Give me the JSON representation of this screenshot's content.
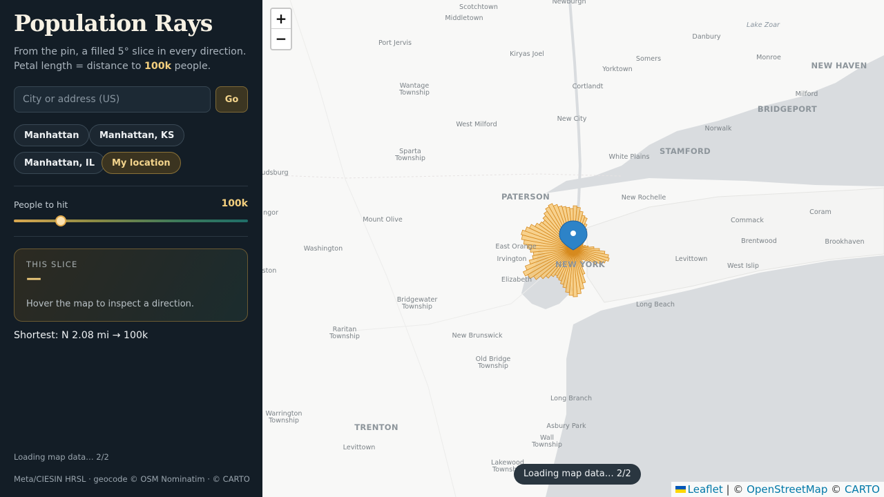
{
  "sidebar": {
    "title": "Population Rays",
    "subtitle_line1": "From the pin, a filled 5° slice in every direction.",
    "subtitle_line2_prefix": "Petal length = distance to",
    "subtitle_line2_highlight": "100k",
    "subtitle_line2_suffix": "people.",
    "search": {
      "placeholder": "City or address (US)",
      "value": "",
      "go_label": "Go"
    },
    "chips": [
      {
        "label": "Manhattan",
        "active": false
      },
      {
        "label": "Manhattan, KS",
        "active": false
      },
      {
        "label": "Manhattan, IL",
        "active": false
      },
      {
        "label": "My location",
        "active": true
      }
    ],
    "people": {
      "label": "People to hit",
      "value_label": "100k",
      "slider_fraction": 0.2
    },
    "slice": {
      "heading": "THIS SLICE",
      "value": "—",
      "hint": "Hover the map to inspect a direction."
    },
    "shortest": "Shortest: N 2.08 mi → 100k",
    "loading": "Loading map data… 2/2",
    "credits": "Meta/CIESIN HRSL · geocode © OSM Nominatim · © CARTO"
  },
  "map": {
    "zoom_in_label": "+",
    "zoom_out_label": "−",
    "loading_pill": "Loading map data… 2/2",
    "attribution": {
      "leaflet": "Leaflet",
      "sep1": " | © ",
      "osm": "OpenStreetMap",
      "sep2": " © ",
      "carto": "CARTO"
    },
    "colors": {
      "petal_fill": "#f7c46a",
      "petal_stroke": "#d68a1f",
      "pin": "#2d83c8",
      "water": "#d9dcdf",
      "land": "#f8f8f7"
    },
    "places": [
      {
        "name": "Scotchtown",
        "type": "town"
      },
      {
        "name": "Newburgh",
        "type": "town"
      },
      {
        "name": "Middletown",
        "type": "town"
      },
      {
        "name": "Port Jervis",
        "type": "town"
      },
      {
        "name": "Kiryas Joel",
        "type": "town"
      },
      {
        "name": "Lake Zoar",
        "type": "water"
      },
      {
        "name": "Danbury",
        "type": "town"
      },
      {
        "name": "Monroe",
        "type": "town"
      },
      {
        "name": "Somers",
        "type": "town"
      },
      {
        "name": "NEW HAVEN",
        "type": "city"
      },
      {
        "name": "Yorktown",
        "type": "town"
      },
      {
        "name": "Wantage Township",
        "type": "town"
      },
      {
        "name": "Cortlandt",
        "type": "town"
      },
      {
        "name": "Milford",
        "type": "town"
      },
      {
        "name": "BRIDGEPORT",
        "type": "city"
      },
      {
        "name": "West Milford",
        "type": "town"
      },
      {
        "name": "New City",
        "type": "town"
      },
      {
        "name": "Norwalk",
        "type": "town"
      },
      {
        "name": "Sparta Township",
        "type": "town"
      },
      {
        "name": "STAMFORD",
        "type": "city"
      },
      {
        "name": "White Plains",
        "type": "town"
      },
      {
        "name": "udsburg",
        "type": "town"
      },
      {
        "name": "PATERSON",
        "type": "city"
      },
      {
        "name": "New Rochelle",
        "type": "town"
      },
      {
        "name": "Coram",
        "type": "town"
      },
      {
        "name": "Commack",
        "type": "town"
      },
      {
        "name": "ngor",
        "type": "town"
      },
      {
        "name": "Mount Olive",
        "type": "town"
      },
      {
        "name": "Brentwood",
        "type": "town"
      },
      {
        "name": "Brookhaven",
        "type": "town"
      },
      {
        "name": "Washington",
        "type": "town"
      },
      {
        "name": "East Orange",
        "type": "town"
      },
      {
        "name": "Levittown",
        "type": "town"
      },
      {
        "name": "Irvington",
        "type": "town"
      },
      {
        "name": "NEW YORK",
        "type": "city"
      },
      {
        "name": "West Islip",
        "type": "town"
      },
      {
        "name": "ston",
        "type": "town"
      },
      {
        "name": "Elizabeth",
        "type": "town"
      },
      {
        "name": "Bridgewater Township",
        "type": "town"
      },
      {
        "name": "Long Beach",
        "type": "town"
      },
      {
        "name": "Raritan Township",
        "type": "town"
      },
      {
        "name": "New Brunswick",
        "type": "town"
      },
      {
        "name": "Old Bridge Township",
        "type": "town"
      },
      {
        "name": "Long Branch",
        "type": "town"
      },
      {
        "name": "Warrington Township",
        "type": "town"
      },
      {
        "name": "TRENTON",
        "type": "city"
      },
      {
        "name": "Asbury Park",
        "type": "town"
      },
      {
        "name": "Wall Township",
        "type": "town"
      },
      {
        "name": "Levittown",
        "type": "town"
      },
      {
        "name": "Lakewood Township",
        "type": "town"
      }
    ]
  }
}
